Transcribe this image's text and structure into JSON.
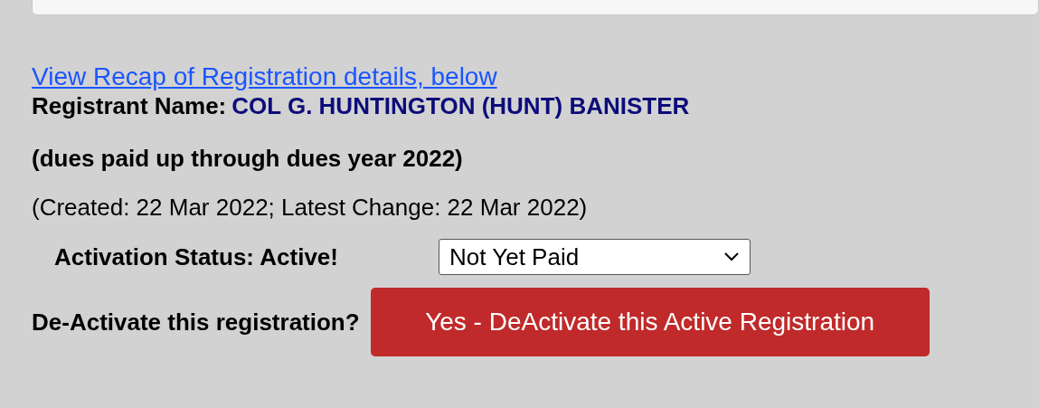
{
  "recap_link": "View Recap of Registration details, below",
  "registrant": {
    "label": "Registrant Name:",
    "name": "COL G. HUNTINGTON (HUNT) BANISTER"
  },
  "dues_note": "(dues paid up through dues year 2022)",
  "dates": "(Created: 22 Mar 2022; Latest Change: 22 Mar 2022)",
  "activation": {
    "label": "Activation Status: Active!",
    "status_select": {
      "value": "Not Yet Paid"
    }
  },
  "deactivate": {
    "label": "De-Activate this registration?",
    "button": "Yes - DeActivate this Active Registration"
  }
}
